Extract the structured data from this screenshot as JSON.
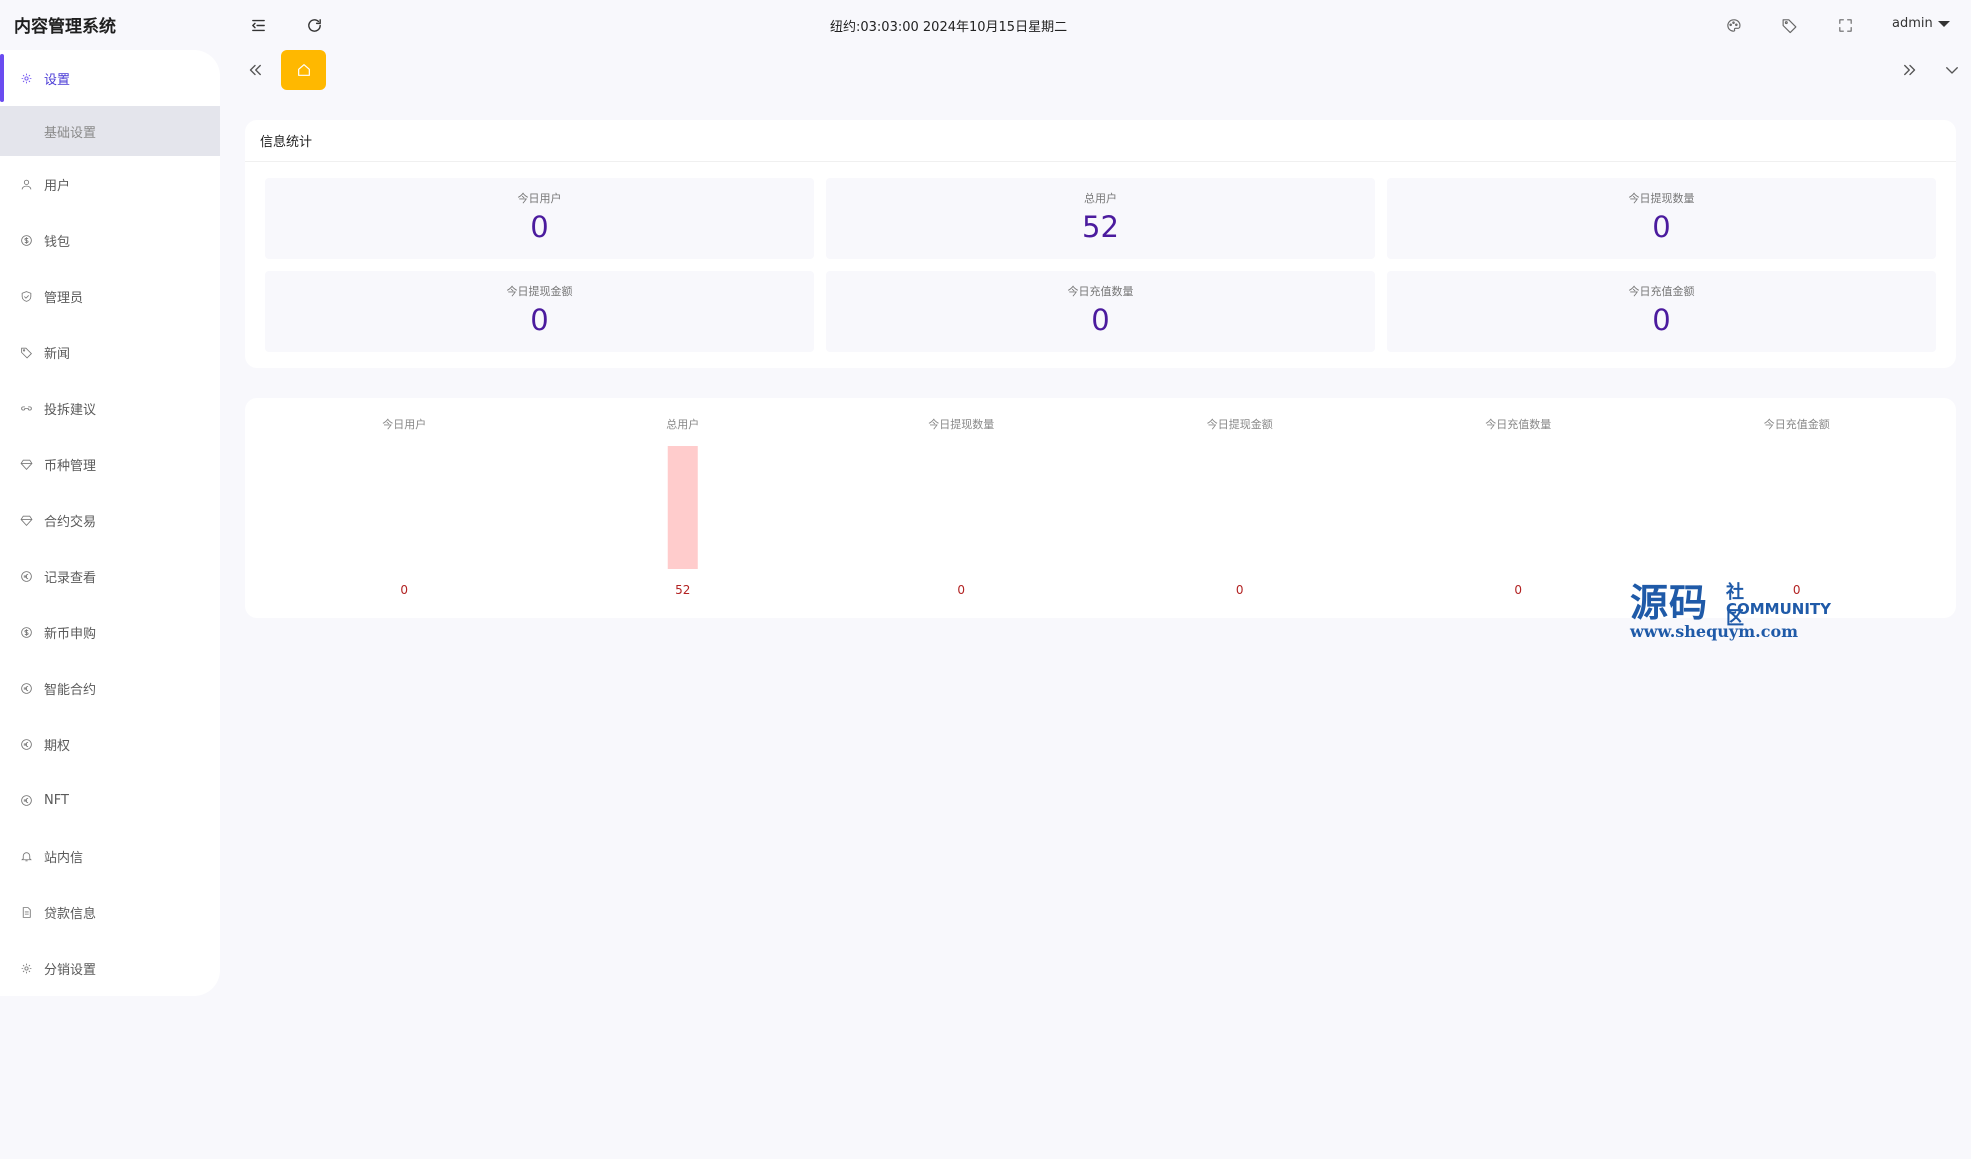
{
  "app": {
    "title": "内容管理系统"
  },
  "header": {
    "clock": "纽约:03:03:00 2024年10月15日星期二",
    "user": "admin"
  },
  "sidebar": {
    "items": [
      {
        "label": "设置",
        "icon": "gear-icon",
        "active": true,
        "sub": [
          {
            "label": "基础设置"
          }
        ]
      },
      {
        "label": "用户",
        "icon": "user-icon"
      },
      {
        "label": "钱包",
        "icon": "dollar-icon"
      },
      {
        "label": "管理员",
        "icon": "shield-icon"
      },
      {
        "label": "新闻",
        "icon": "tag-icon"
      },
      {
        "label": "投拆建议",
        "icon": "link-icon"
      },
      {
        "label": "币种管理",
        "icon": "diamond-icon"
      },
      {
        "label": "合约交易",
        "icon": "diamond-icon"
      },
      {
        "label": "记录查看",
        "icon": "euro-icon"
      },
      {
        "label": "新币申购",
        "icon": "dollar-icon"
      },
      {
        "label": "智能合约",
        "icon": "euro-icon"
      },
      {
        "label": "期权",
        "icon": "euro-icon"
      },
      {
        "label": "NFT",
        "icon": "euro-icon"
      },
      {
        "label": "站内信",
        "icon": "bell-icon"
      },
      {
        "label": "贷款信息",
        "icon": "doc-icon"
      },
      {
        "label": "分销设置",
        "icon": "gear-icon"
      }
    ]
  },
  "stats": {
    "title": "信息统计",
    "items": [
      {
        "label": "今日用户",
        "value": "0"
      },
      {
        "label": "总用户",
        "value": "52"
      },
      {
        "label": "今日提现数量",
        "value": "0"
      },
      {
        "label": "今日提现金额",
        "value": "0"
      },
      {
        "label": "今日充值数量",
        "value": "0"
      },
      {
        "label": "今日充值金额",
        "value": "0"
      }
    ]
  },
  "chart_data": {
    "type": "bar",
    "categories": [
      "今日用户",
      "总用户",
      "今日提现数量",
      "今日提现金额",
      "今日充值数量",
      "今日充值金额"
    ],
    "values": [
      0,
      52,
      0,
      0,
      0,
      0
    ],
    "ylim": [
      0,
      52
    ],
    "grid": false,
    "bar_color": "#ffcccc",
    "label_color": "#b22222"
  },
  "watermark": {
    "main": "源码",
    "sub": "社区",
    "community": "COMMUNITY",
    "url": "www.shequym.com"
  },
  "colors": {
    "accent": "#6a4cf0",
    "home_tab": "#ffb800",
    "stat_value": "#4b1b9e"
  }
}
